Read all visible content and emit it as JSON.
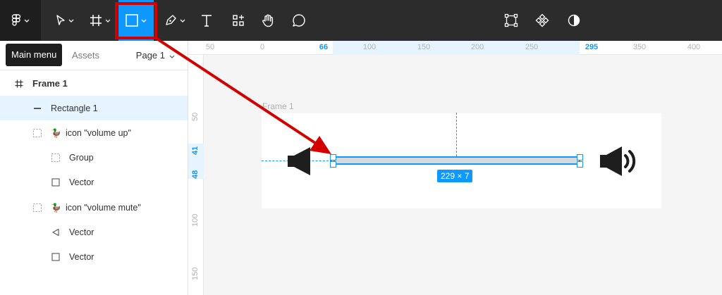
{
  "toolbar": {
    "tools": [
      "main-menu",
      "move",
      "frame",
      "rectangle",
      "pen",
      "text",
      "resources",
      "hand",
      "comment",
      "edit-object",
      "components",
      "contrast"
    ]
  },
  "tooltip": {
    "label": "Main menu"
  },
  "left_panel": {
    "assets_tab": "Assets",
    "page": "Page 1",
    "layers": [
      {
        "name": "Frame 1"
      },
      {
        "name": "Rectangle 1"
      },
      {
        "name": "icon \"volume up\"",
        "emoji": "🦆"
      },
      {
        "name": "Group"
      },
      {
        "name": "Vector"
      },
      {
        "name": "icon \"volume mute\"",
        "emoji": "🦆"
      },
      {
        "name": "Vector"
      },
      {
        "name": "Vector"
      }
    ]
  },
  "rulers": {
    "top": [
      "0",
      "66",
      "100",
      "150",
      "200",
      "250",
      "295",
      "350",
      "400"
    ],
    "top_left_partial": "50",
    "left": [
      "41",
      "48",
      "100",
      "150"
    ],
    "left_partial": "50"
  },
  "canvas": {
    "frame_label": "Frame 1",
    "size_badge": "229 × 7"
  },
  "colors": {
    "accent": "#0d99ff",
    "toolbar_bg": "#2c2c2c",
    "selection_bg": "#e5f4ff",
    "annotation_red": "#d40000"
  }
}
